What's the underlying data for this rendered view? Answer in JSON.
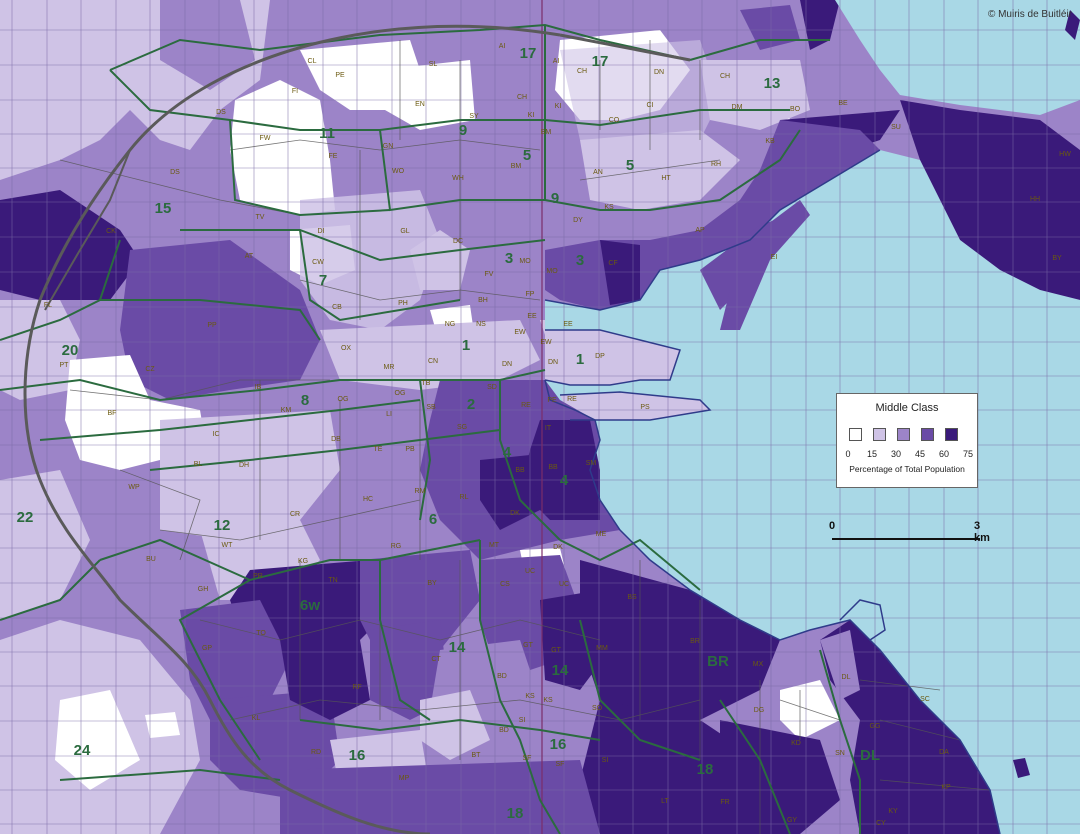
{
  "copyright": "© Muiris de Buitléir",
  "legend": {
    "title": "Middle Class",
    "caption": "Percentage of Total Population",
    "ticks": [
      "0",
      "15",
      "30",
      "45",
      "60",
      "75"
    ],
    "swatch_colors": [
      "#ffffff",
      "#cfc3e6",
      "#9c84c8",
      "#6a4ba6",
      "#3a1a7a"
    ]
  },
  "scale": {
    "start": "0",
    "end": "3 km"
  },
  "colors": {
    "sea": "#a9d8e6",
    "district_border": "#2b6b3f",
    "ward_border": "#555555",
    "grid": "#7a6aa6",
    "motorway": "#5a5a5a"
  },
  "district_labels": [
    "17",
    "17",
    "13",
    "11",
    "9",
    "5",
    "5",
    "15",
    "9",
    "3",
    "3",
    "7",
    "1",
    "1",
    "20",
    "2",
    "8",
    "4",
    "4",
    "6",
    "12",
    "22",
    "6w",
    "14",
    "14",
    "BR",
    "16",
    "DL",
    "18",
    "24",
    "16",
    "18"
  ],
  "area_codes": [
    "CL",
    "PE",
    "SL",
    "AI",
    "AI",
    "CH",
    "DN",
    "CH",
    "DS",
    "FI",
    "EN",
    "SY",
    "CH",
    "KI",
    "KI",
    "CO",
    "CI",
    "DM",
    "BO",
    "BE",
    "FW",
    "BM",
    "SU",
    "KB",
    "FE",
    "GN",
    "BM",
    "AN",
    "HT",
    "RH",
    "DS",
    "WO",
    "WH",
    "HW",
    "HH",
    "TV",
    "DI",
    "DY",
    "KS",
    "AP",
    "CK",
    "GL",
    "DC",
    "AT",
    "CW",
    "FV",
    "MO",
    "MO",
    "CF",
    "EI",
    "BY",
    "BH",
    "FP",
    "CB",
    "PH",
    "FL",
    "PP",
    "NG",
    "NS",
    "EE",
    "EE",
    "EW",
    "OX",
    "CN",
    "DN",
    "DN",
    "DP",
    "EW",
    "PT",
    "MR",
    "CZ",
    "IB",
    "TB",
    "OG",
    "SD",
    "RE",
    "KM",
    "OG",
    "SB",
    "PE",
    "RE",
    "PS",
    "LI",
    "BF",
    "SG",
    "IT",
    "IC",
    "DB",
    "TE",
    "PB",
    "BB",
    "BB",
    "SM",
    "DH",
    "BL",
    "WP",
    "RM",
    "RL",
    "CR",
    "HC",
    "DK",
    "WT",
    "RG",
    "MT",
    "DK",
    "ME",
    "BU",
    "KG",
    "CS",
    "UC",
    "UC",
    "TN",
    "PR",
    "BY",
    "GH",
    "BS",
    "TO",
    "GP",
    "GT",
    "GT",
    "MM",
    "BR",
    "MX",
    "CT",
    "RF",
    "BD",
    "KS",
    "DL",
    "KL",
    "KS",
    "SO",
    "DG",
    "KD",
    "SI",
    "GG",
    "SC",
    "BD",
    "SN",
    "DA",
    "RD",
    "SF",
    "SF",
    "MP",
    "BT",
    "SI",
    "KP",
    "LT",
    "FR",
    "KY",
    "GY",
    "CY"
  ]
}
